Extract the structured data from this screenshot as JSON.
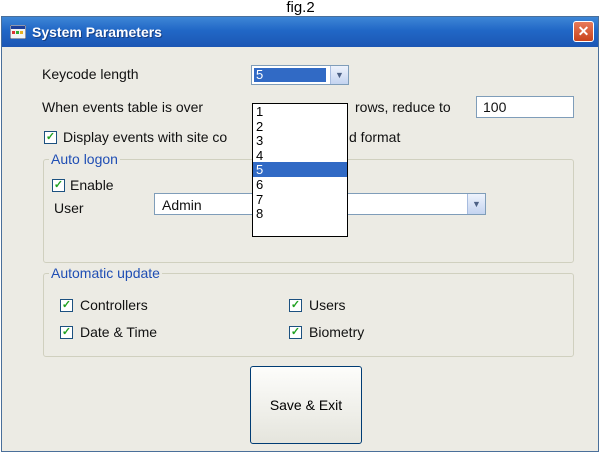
{
  "caption": "fig.2",
  "window": {
    "title": "System Parameters",
    "close_glyph": "✕"
  },
  "form": {
    "keycode_label": "Keycode length",
    "keycode_value": "5",
    "keycode_options": [
      "1",
      "2",
      "3",
      "4",
      "5",
      "6",
      "7",
      "8"
    ],
    "events_label": "When events table is over",
    "events_reduce_label": "rows, reduce to",
    "events_reduce_value": "100",
    "display_events_label_a": "Display events with site co",
    "display_events_label_b": "d format",
    "display_events_checked": true
  },
  "auto_logon": {
    "title": "Auto logon",
    "enable_label": "Enable",
    "enable_checked": true,
    "user_label": "User",
    "user_value": "Admin"
  },
  "auto_update": {
    "title": "Automatic update",
    "controllers_label": "Controllers",
    "users_label": "Users",
    "datetime_label": "Date & Time",
    "biometry_label": "Biometry",
    "check_glyph": "✓"
  },
  "buttons": {
    "save_exit": "Save & Exit"
  },
  "icons": {
    "combo_arrow": "▼"
  }
}
